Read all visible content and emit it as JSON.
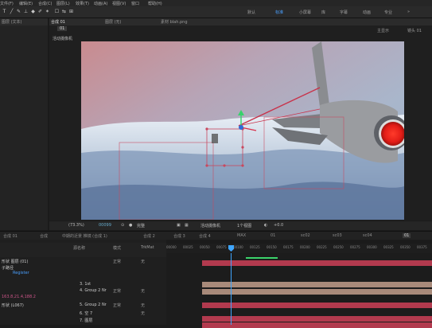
{
  "menu": {
    "items": [
      "文件(F)",
      "编辑(E)",
      "合成(C)",
      "图层(L)",
      "效果(T)",
      "动画(A)",
      "视图(V)",
      "窗口",
      "帮助(H)"
    ]
  },
  "workspaces": {
    "items": [
      "默认",
      "标准",
      "小屏幕",
      "库",
      "字幕",
      "动画",
      "专业"
    ],
    "active": "标准"
  },
  "left_panel": {
    "label": "图层 (文本)"
  },
  "comp_tabs": {
    "items": [
      "图层 (无)",
      "素材 blah.png"
    ],
    "comp_label": "合成 01",
    "active": "01"
  },
  "viewer": {
    "header": "活动摄像机",
    "right_label": "主显示",
    "cam_label": "镜头 01"
  },
  "controls": {
    "zoom": "(73.3%)",
    "timecode": "00099",
    "quality": "完整",
    "camera": "活动摄像机",
    "views": "1个视图",
    "exposure": "+0.0"
  },
  "timeline_tabs": {
    "items": [
      "合成 01",
      "合成",
      "中期的近景 推镜 (合成 1)",
      "合成 2",
      "合成 3",
      "合成 4",
      "MAX",
      "01",
      "sc02",
      "sc03",
      "sc04",
      "sc05"
    ],
    "active": "01"
  },
  "timeline": {
    "header": {
      "source_col": "源名称",
      "mode_col": "模式",
      "trkmat_col": "TrkMat"
    },
    "ticks": [
      "00000",
      "00025",
      "00050",
      "00075",
      "00100",
      "00125",
      "00150",
      "00175",
      "00200",
      "00225",
      "00250",
      "00275",
      "00300",
      "00325",
      "00350",
      "00375"
    ],
    "layers": [
      {
        "name": "形状 图层 (01)",
        "mode": "正常",
        "trk": "无"
      },
      {
        "name": "子路径",
        "mode": "",
        "trk": ""
      },
      {
        "name": "Register",
        "mode": "",
        "trk": ""
      },
      {
        "name": "3. 1st",
        "mode": "正常",
        "trk": "无"
      },
      {
        "name": "4. Group 2 Nr",
        "mode": "正常",
        "trk": "无"
      },
      {
        "name": "5. Group 2 Nr",
        "mode": "正常",
        "trk": "无"
      },
      {
        "name": "6. 空 7",
        "mode": "正常",
        "trk": "无"
      },
      {
        "name": "7. 图层",
        "mode": "正常",
        "trk": "无"
      }
    ],
    "value_readout": "163.8,21.4,188.2",
    "bottom_label": "形状 (L067)"
  },
  "colors": {
    "accent": "#4aa0ff",
    "layer_red": "#b23a4e",
    "layer_tan": "#a88a7a",
    "playhead": "#3fa6ff"
  }
}
